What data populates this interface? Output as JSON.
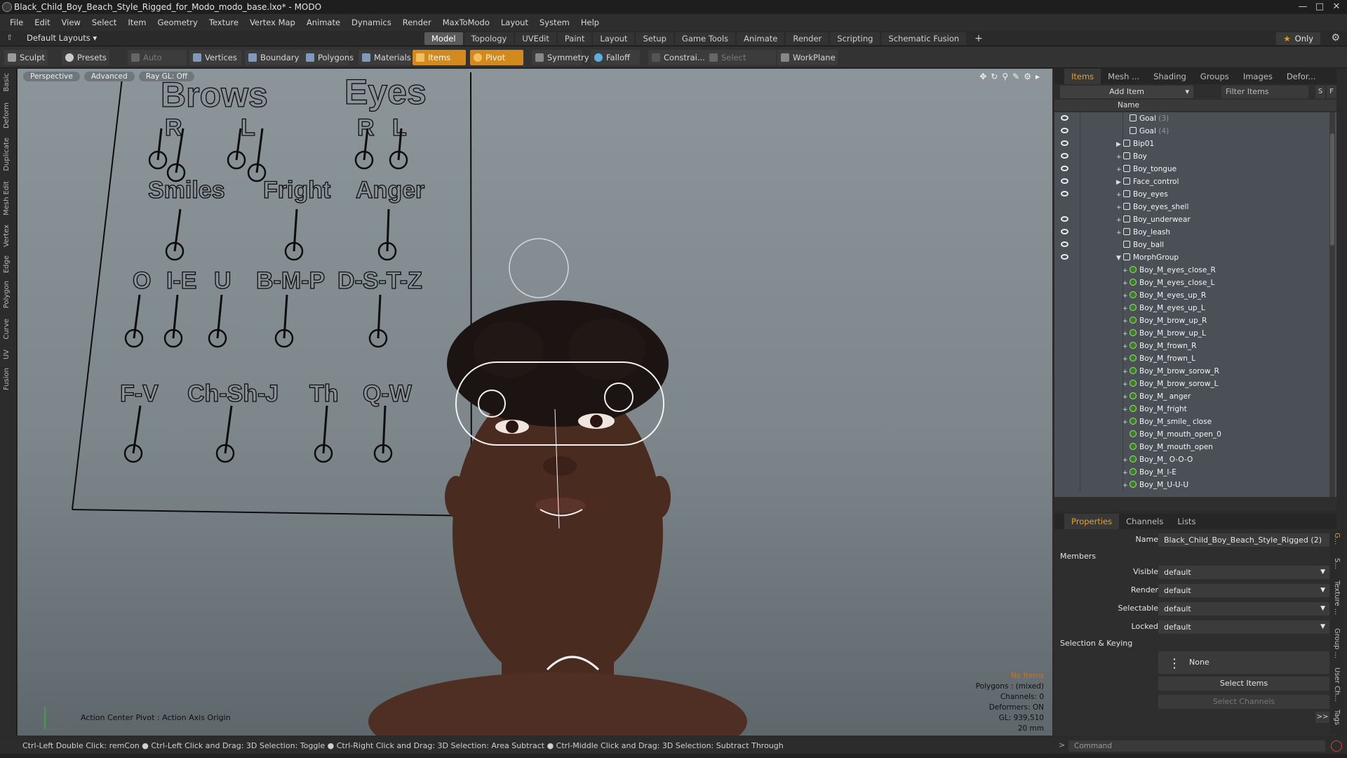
{
  "title": "Black_Child_Boy_Beach_Style_Rigged_for_Modo_modo_base.lxo* - MODO",
  "menu": [
    "File",
    "Edit",
    "View",
    "Select",
    "Item",
    "Geometry",
    "Texture",
    "Vertex Map",
    "Animate",
    "Dynamics",
    "Render",
    "MaxToModo",
    "Layout",
    "System",
    "Help"
  ],
  "layout_label": "Default Layouts ▾",
  "tabs": [
    "Model",
    "Topology",
    "UVEdit",
    "Paint",
    "Layout",
    "Setup",
    "Game Tools",
    "Animate",
    "Render",
    "Scripting",
    "Schematic Fusion"
  ],
  "only_label": "Only",
  "toolbar": {
    "sculpt": "Sculpt",
    "presets": "Presets",
    "auto_select": "Auto Select",
    "vertices": "Vertices",
    "boundary": "Boundary",
    "polygons": "Polygons",
    "materials": "Materials",
    "items": "Items",
    "pivot": "Pivot",
    "symmetry": "Symmetry",
    "falloff": "Falloff",
    "constrain": "Constrai...",
    "select_through": "Select Through",
    "workplane": "WorkPlane"
  },
  "left_tabs": [
    "Basic",
    "Deform",
    "Duplicate",
    "Mesh Edit",
    "Vertex",
    "Edge",
    "Polygon",
    "Curve",
    "UV",
    "Fusion"
  ],
  "viewport": {
    "buttons": [
      "Perspective",
      "Advanced",
      "Ray GL: Off"
    ],
    "action_center": "Action Center Pivot : Action Axis Origin",
    "stats": {
      "no_items": "No Items",
      "polygons": "Polygons : (mixed)",
      "channels": "Channels: 0",
      "deformers": "Deformers: ON",
      "gl": "GL: 939,510",
      "scale": "20 mm"
    },
    "board": {
      "brows": "Brows",
      "eyes": "Eyes",
      "r1": "R",
      "l1": "L",
      "r2": "R",
      "l2": "L",
      "smiles": "Smiles",
      "fright": "Fright",
      "anger": "Anger",
      "o": "O",
      "ie": "I-E",
      "u": "U",
      "bmp": "B-M-P",
      "dstz": "D-S-T-Z",
      "fv": "F-V",
      "chshj": "Ch-Sh-J",
      "th": "Th",
      "qw": "Q-W"
    }
  },
  "status": "Ctrl-Left Double Click: remCon ● Ctrl-Left Click and Drag: 3D Selection: Toggle ● Ctrl-Right Click and Drag: 3D Selection: Area Subtract ● Ctrl-Middle Click and Drag: 3D Selection: Subtract Through",
  "items_panel": {
    "tabs": [
      "Items",
      "Mesh ...",
      "Shading",
      "Groups",
      "Images",
      "Defor..."
    ],
    "add_item": "Add Item",
    "filter": "Filter Items",
    "column_name": "Name",
    "rows": [
      {
        "label": "Goal",
        "count": "(3)",
        "eye": true,
        "depth": 3,
        "exp": "",
        "morph": false
      },
      {
        "label": "Goal",
        "count": "(4)",
        "eye": true,
        "depth": 3,
        "exp": "",
        "morph": false
      },
      {
        "label": "Bip01",
        "count": "",
        "eye": true,
        "depth": 2,
        "exp": "▶",
        "morph": false
      },
      {
        "label": "Boy",
        "count": "",
        "eye": true,
        "depth": 2,
        "exp": "+",
        "morph": false
      },
      {
        "label": "Boy_tongue",
        "count": "",
        "eye": true,
        "depth": 2,
        "exp": "+",
        "morph": false
      },
      {
        "label": "Face_control",
        "count": "",
        "eye": true,
        "depth": 2,
        "exp": "▶",
        "morph": false
      },
      {
        "label": "Boy_eyes",
        "count": "",
        "eye": true,
        "depth": 2,
        "exp": "+",
        "morph": false
      },
      {
        "label": "Boy_eyes_shell",
        "count": "",
        "eye": false,
        "depth": 2,
        "exp": "+",
        "morph": false
      },
      {
        "label": "Boy_underwear",
        "count": "",
        "eye": true,
        "depth": 2,
        "exp": "+",
        "morph": false
      },
      {
        "label": "Boy_leash",
        "count": "",
        "eye": true,
        "depth": 2,
        "exp": "+",
        "morph": false
      },
      {
        "label": "Boy_ball",
        "count": "",
        "eye": true,
        "depth": 2,
        "exp": "",
        "morph": false
      },
      {
        "label": "MorphGroup",
        "count": "",
        "eye": true,
        "depth": 2,
        "exp": "▼",
        "morph": false
      },
      {
        "label": "Boy_M_eyes_close_R",
        "count": "",
        "eye": false,
        "depth": 3,
        "exp": "+",
        "morph": true
      },
      {
        "label": "Boy_M_eyes_close_L",
        "count": "",
        "eye": false,
        "depth": 3,
        "exp": "+",
        "morph": true
      },
      {
        "label": "Boy_M_eyes_up_R",
        "count": "",
        "eye": false,
        "depth": 3,
        "exp": "+",
        "morph": true
      },
      {
        "label": "Boy_M_eyes_up_L",
        "count": "",
        "eye": false,
        "depth": 3,
        "exp": "+",
        "morph": true
      },
      {
        "label": "Boy_M_brow_up_R",
        "count": "",
        "eye": false,
        "depth": 3,
        "exp": "+",
        "morph": true
      },
      {
        "label": "Boy_M_brow_up_L",
        "count": "",
        "eye": false,
        "depth": 3,
        "exp": "+",
        "morph": true
      },
      {
        "label": "Boy_M_frown_R",
        "count": "",
        "eye": false,
        "depth": 3,
        "exp": "+",
        "morph": true
      },
      {
        "label": "Boy_M_frown_L",
        "count": "",
        "eye": false,
        "depth": 3,
        "exp": "+",
        "morph": true
      },
      {
        "label": "Boy_M_brow_sorow_R",
        "count": "",
        "eye": false,
        "depth": 3,
        "exp": "+",
        "morph": true
      },
      {
        "label": "Boy_M_brow_sorow_L",
        "count": "",
        "eye": false,
        "depth": 3,
        "exp": "+",
        "morph": true
      },
      {
        "label": "Boy_M_ anger",
        "count": "",
        "eye": false,
        "depth": 3,
        "exp": "+",
        "morph": true
      },
      {
        "label": "Boy_M_fright",
        "count": "",
        "eye": false,
        "depth": 3,
        "exp": "+",
        "morph": true
      },
      {
        "label": "Boy_M_smile_ close",
        "count": "",
        "eye": false,
        "depth": 3,
        "exp": "+",
        "morph": true
      },
      {
        "label": "Boy_M_mouth_open_0",
        "count": "",
        "eye": false,
        "depth": 3,
        "exp": "",
        "morph": true
      },
      {
        "label": "Boy_M_mouth_open",
        "count": "",
        "eye": false,
        "depth": 3,
        "exp": "",
        "morph": true
      },
      {
        "label": "Boy_M_ O-O-O",
        "count": "",
        "eye": false,
        "depth": 3,
        "exp": "+",
        "morph": true
      },
      {
        "label": "Boy_M_I-E",
        "count": "",
        "eye": false,
        "depth": 3,
        "exp": "+",
        "morph": true
      },
      {
        "label": "Boy_M_U-U-U",
        "count": "",
        "eye": false,
        "depth": 3,
        "exp": "+",
        "morph": true
      }
    ]
  },
  "properties": {
    "tabs": [
      "Properties",
      "Channels",
      "Lists"
    ],
    "name_label": "Name",
    "name_value": "Black_Child_Boy_Beach_Style_Rigged (2)",
    "members": "Members",
    "visible_label": "Visible",
    "visible_value": "default",
    "render_label": "Render",
    "render_value": "default",
    "selectable_label": "Selectable",
    "selectable_value": "default",
    "locked_label": "Locked",
    "locked_value": "default",
    "sel_keying": "Selection & Keying",
    "none": "None",
    "select_items": "Select Items",
    "select_channels": "Select Channels",
    "right_tabs": [
      "G...",
      "S...",
      "Texture ...",
      "Group ...",
      "User Ch...",
      "Tags"
    ]
  },
  "command_placeholder": "Command"
}
